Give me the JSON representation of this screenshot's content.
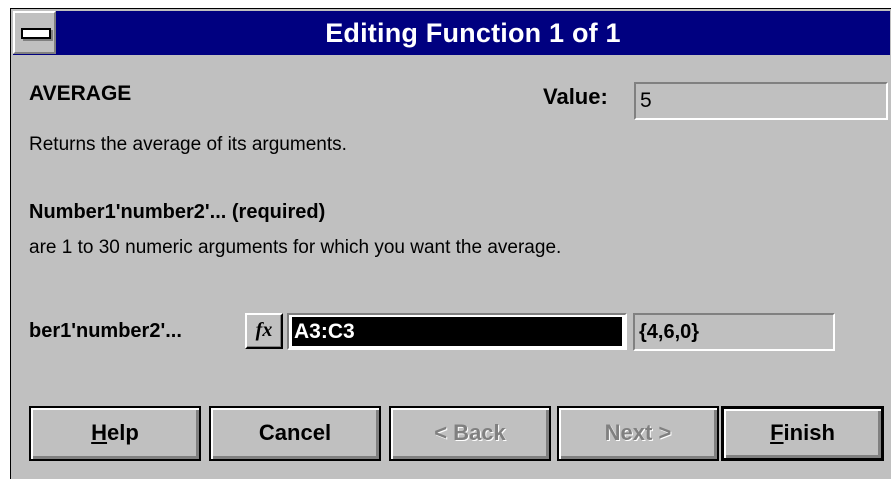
{
  "window": {
    "title": "Editing Function 1 of 1"
  },
  "function": {
    "name": "AVERAGE",
    "value_label": "Value:",
    "value": "5",
    "description": "Returns the average of its arguments."
  },
  "argument": {
    "title": "Number1'number2'... (required)",
    "description": "are 1 to 30 numeric arguments for which you want the average.",
    "label": "ber1'number2'...",
    "fx_label": "fx",
    "input_value": "A3:C3",
    "result": "{4,6,0}"
  },
  "buttons": {
    "help": {
      "access_key": "H",
      "rest": "elp"
    },
    "cancel": "Cancel",
    "back": "< Back",
    "next": "Next >",
    "finish": {
      "access_key": "F",
      "rest": "inish"
    }
  }
}
